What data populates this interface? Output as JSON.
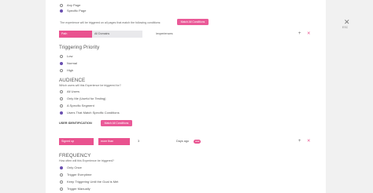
{
  "close": {
    "icon": "close-icon",
    "label": "ESC"
  },
  "page_scope": {
    "options": [
      {
        "label": "Any Page",
        "selected": false
      },
      {
        "label": "Specific Page",
        "selected": true
      }
    ],
    "condition_text": "The experience will be triggered on all pages that match the following conditions:",
    "match_button": "Match All Conditions",
    "rule": {
      "field": "Path",
      "operator": "All Domains",
      "value": "/experiences"
    }
  },
  "triggering_priority": {
    "title": "Triggering Priority",
    "options": [
      {
        "label": "Low",
        "selected": false
      },
      {
        "label": "Normal",
        "selected": true
      },
      {
        "label": "High",
        "selected": false
      }
    ]
  },
  "audience": {
    "title": "AUDIENCE",
    "subtitle": "Which users will this Experience be triggered for?",
    "options": [
      {
        "label": "All Users",
        "selected": false
      },
      {
        "label": "Only Me (Useful for Testing)",
        "selected": false
      },
      {
        "label": "A Specific Segment",
        "selected": false
      },
      {
        "label": "Users That Match Specific Conditions",
        "selected": true
      }
    ]
  },
  "user_identification": {
    "label": "USER IDENTIFICATION",
    "match_button": "Match All Conditions",
    "rule": {
      "field": "Signed up",
      "operator": "more than",
      "value": "3",
      "unit": "Days ago",
      "chip": "●●●"
    }
  },
  "frequency": {
    "title": "FREQUENCY",
    "subtitle": "How often will this Experience be triggered?",
    "options": [
      {
        "label": "Only Once",
        "selected": true
      },
      {
        "label": "Trigger Everytime",
        "selected": false
      },
      {
        "label": "Keep Triggering Until the Goal is Met",
        "selected": false
      },
      {
        "label": "Trigger Manually",
        "selected": false
      }
    ]
  },
  "colors": {
    "accent": "#e9528f",
    "radio_selected": "#6a4fb0",
    "backdrop": "#f1f1f1"
  }
}
